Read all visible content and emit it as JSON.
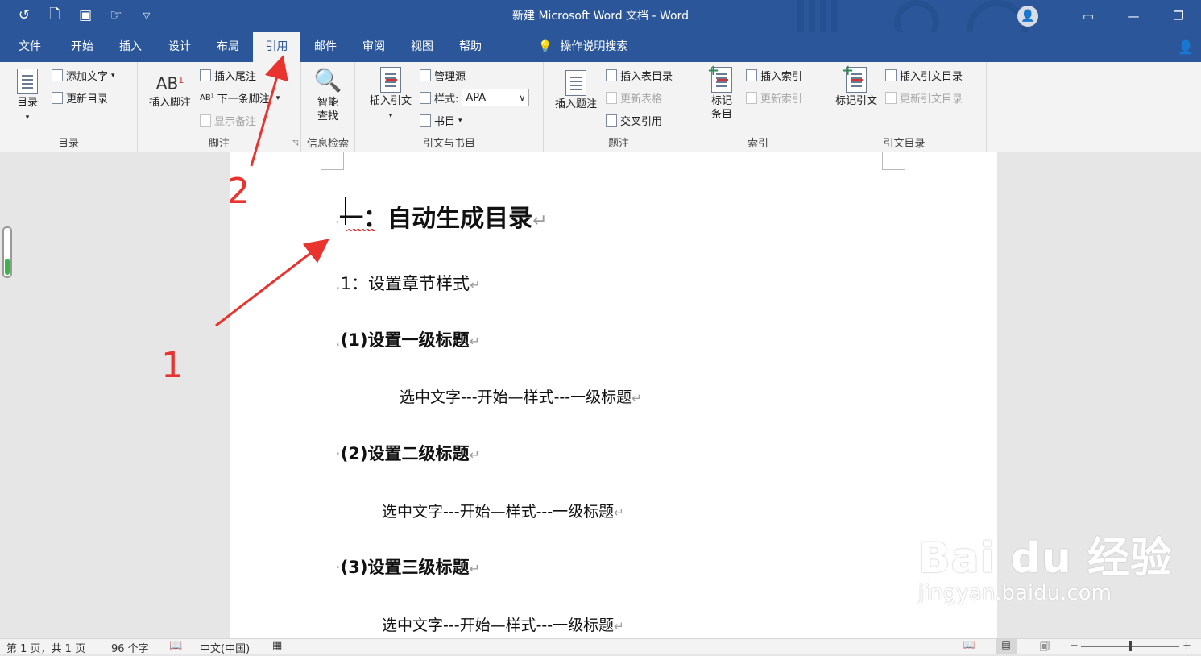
{
  "window": {
    "title": "新建 Microsoft Word 文档  -  Word"
  },
  "qat": {
    "items": [
      "undo-icon",
      "print-preview-icon",
      "save-icon",
      "touch-mode-icon",
      "customize-qat-icon"
    ]
  },
  "tabs": [
    "文件",
    "开始",
    "插入",
    "设计",
    "布局",
    "引用",
    "邮件",
    "审阅",
    "视图",
    "帮助"
  ],
  "active_tab": "引用",
  "tell_me": "操作说明搜索",
  "ribbon": {
    "toc": {
      "label": "目录",
      "toc_button": "目录",
      "add_text": "添加文字",
      "update_toc": "更新目录"
    },
    "footnotes": {
      "label": "脚注",
      "insert_footnote": "插入脚注",
      "ab_glyph": "AB",
      "sup": "1",
      "insert_endnote": "插入尾注",
      "next_footnote": "下一条脚注",
      "show_notes": "显示备注"
    },
    "research": {
      "label": "信息检索",
      "smart_lookup_1": "智能",
      "smart_lookup_2": "查找"
    },
    "citations": {
      "label": "引文与书目",
      "insert_citation": "插入引文",
      "manage_sources": "管理源",
      "style_label": "样式:",
      "style_value": "APA",
      "bibliography": "书目"
    },
    "captions": {
      "label": "题注",
      "insert_caption": "插入题注",
      "insert_tof": "插入表目录",
      "update_table": "更新表格",
      "cross_ref": "交叉引用"
    },
    "index": {
      "label": "索引",
      "mark_entry_1": "标记",
      "mark_entry_2": "条目",
      "insert_index": "插入索引",
      "update_index": "更新索引"
    },
    "toa": {
      "label": "引文目录",
      "mark_citation": "标记引文",
      "insert_toa": "插入引文目录",
      "update_toa": "更新引文目录"
    }
  },
  "document": {
    "h1": "一：自动生成目录",
    "h2": "1：设置章节样式",
    "items": [
      {
        "heading": "(1)设置一级标题",
        "body": "选中文字---开始—样式---一级标题"
      },
      {
        "heading": "(2)设置二级标题",
        "body": "选中文字---开始—样式---一级标题"
      },
      {
        "heading": "(3)设置三级标题",
        "body": "选中文字---开始—样式---一级标题"
      }
    ],
    "para_mark": "↵"
  },
  "annotations": {
    "step1": "1",
    "step2": "2"
  },
  "watermark": {
    "brand": "Bai du 经验",
    "url": "jingyan.baidu.com"
  },
  "status": {
    "page": "第 1 页，共 1 页",
    "words": "96 个字",
    "language": "中文(中国)"
  }
}
